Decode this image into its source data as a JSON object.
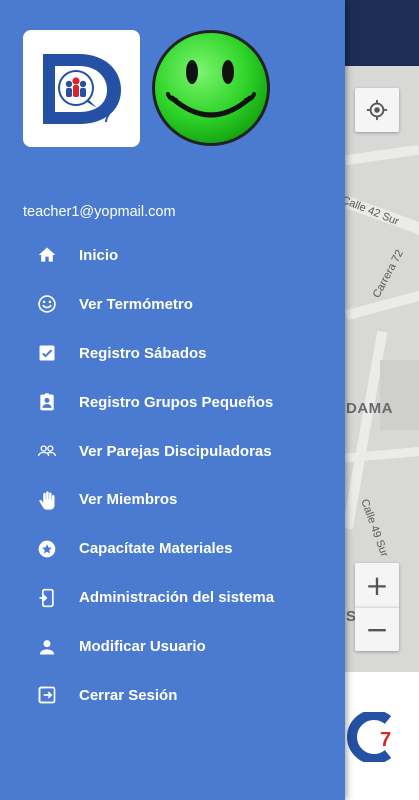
{
  "map": {
    "street_labels": [
      "Calle 42 Sur",
      "Carrera 72",
      "DAMA",
      "Calle 49 Sur",
      "S"
    ],
    "zoom_in_label": "+",
    "zoom_out_label": "−",
    "locate_icon": "crosshair-icon"
  },
  "drawer": {
    "email": "teacher1@yopmail.com",
    "logo_icon": "app-logo-d7",
    "avatar_icon": "smiley-face",
    "items": [
      {
        "label": "Inicio",
        "icon": "home-icon"
      },
      {
        "label": "Ver Termómetro",
        "icon": "smiley-icon"
      },
      {
        "label": "Registro Sábados",
        "icon": "checkbox-icon"
      },
      {
        "label": "Registro Grupos Pequeños",
        "icon": "badge-icon"
      },
      {
        "label": "Ver Parejas Discipuladoras",
        "icon": "people-icon"
      },
      {
        "label": "Ver Miembros",
        "icon": "hand-icon"
      },
      {
        "label": "Capacítate Materiales",
        "icon": "star-circle-icon"
      },
      {
        "label": "Administración del sistema",
        "icon": "phone-exit-icon"
      },
      {
        "label": "Modificar Usuario",
        "icon": "person-icon"
      },
      {
        "label": "Cerrar Sesión",
        "icon": "logout-icon"
      }
    ]
  },
  "colors": {
    "drawer_bg": "#4a7bd0",
    "topbar": "#1d2d55",
    "logo_blue": "#2451a4",
    "logo_red": "#d8262c",
    "smiley_green": "#2fd42a"
  }
}
